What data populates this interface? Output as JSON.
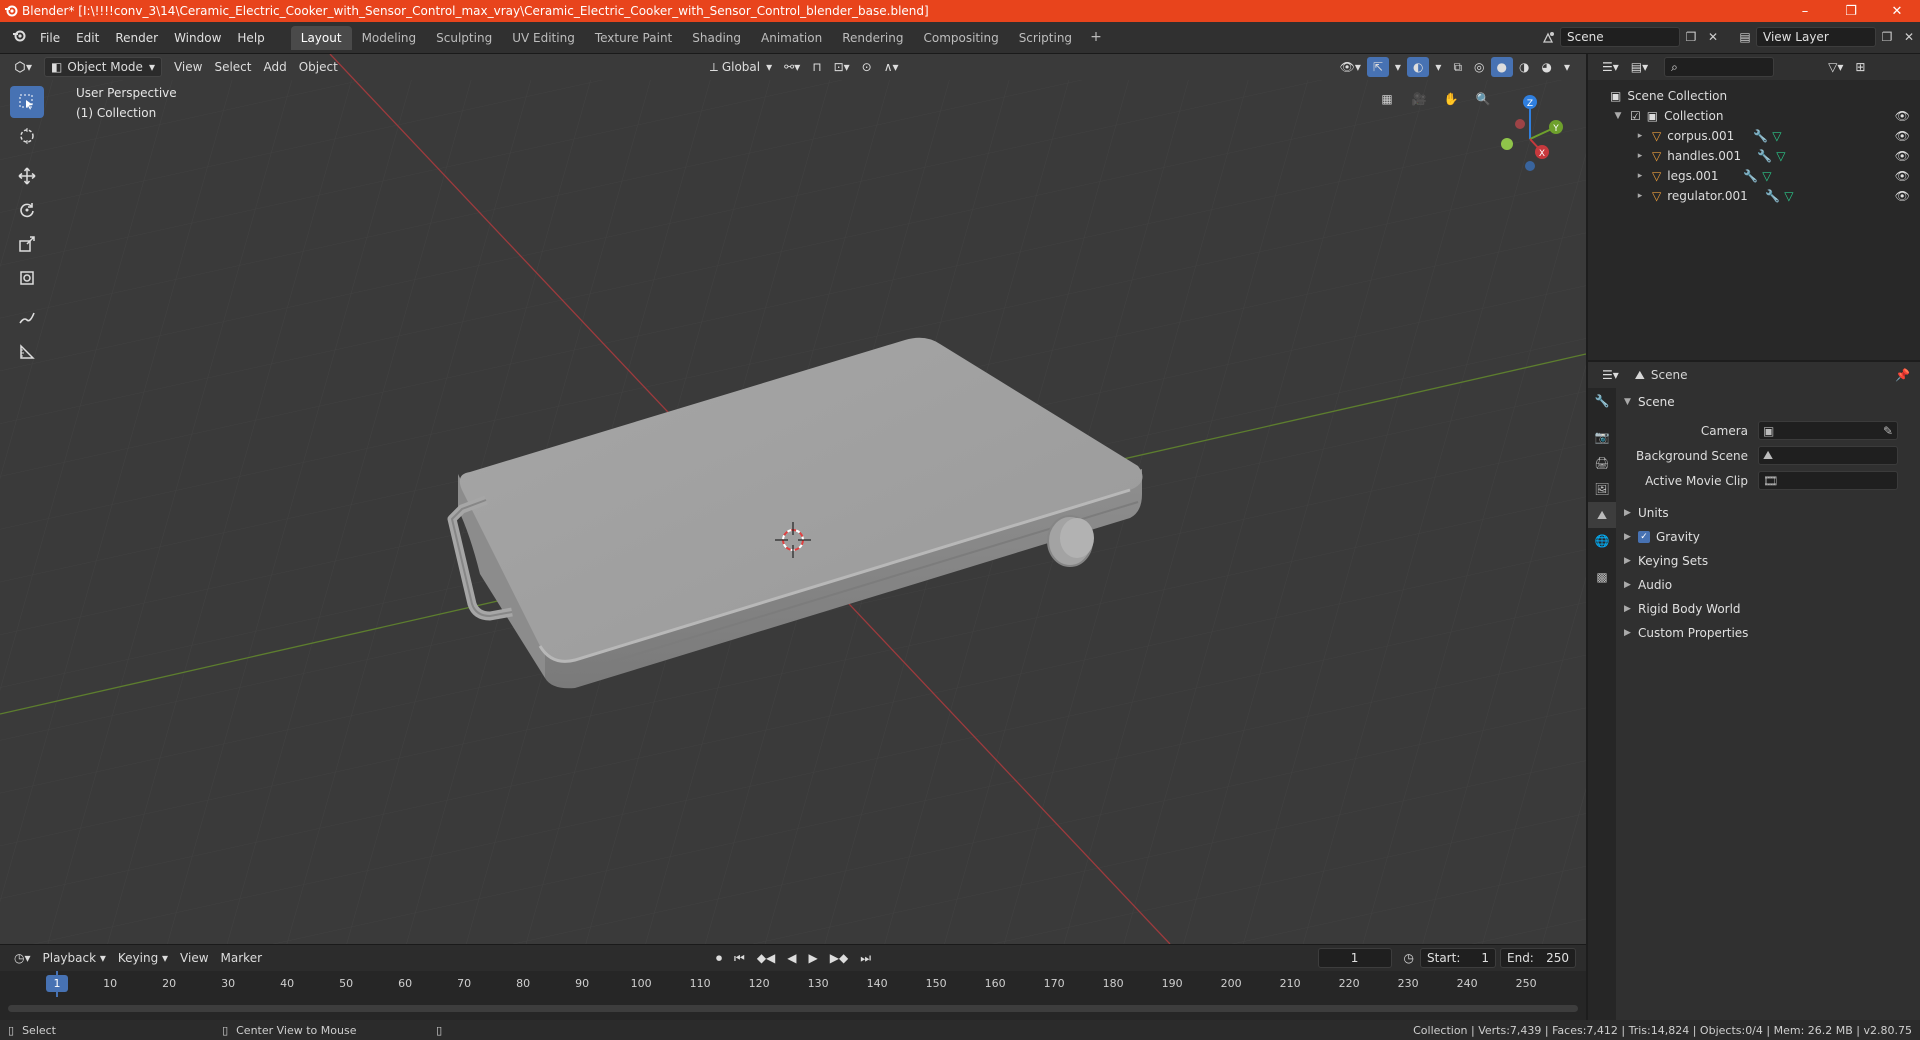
{
  "window": {
    "title": "Blender* [I:\\!!!!conv_3\\14\\Ceramic_Electric_Cooker_with_Sensor_Control_max_vray\\Ceramic_Electric_Cooker_with_Sensor_Control_blender_base.blend]",
    "minimize": "–",
    "maximize": "❐",
    "close": "✕"
  },
  "menu": [
    "File",
    "Edit",
    "Render",
    "Window",
    "Help"
  ],
  "workspaces": [
    "Layout",
    "Modeling",
    "Sculpting",
    "UV Editing",
    "Texture Paint",
    "Shading",
    "Animation",
    "Rendering",
    "Compositing",
    "Scripting"
  ],
  "active_workspace": "Layout",
  "scene_field": "Scene",
  "view_layer_field": "View Layer",
  "viewport": {
    "mode": "Object Mode",
    "menus": [
      "View",
      "Select",
      "Add",
      "Object"
    ],
    "transform_orientation": "Global",
    "perspective_label": "User Perspective",
    "collection_label": "(1) Collection",
    "gizmo_axes": {
      "x": "X",
      "y": "Y",
      "z": "Z"
    }
  },
  "timeline": {
    "menus": [
      "Playback",
      "Keying",
      "View",
      "Marker"
    ],
    "current_frame": "1",
    "start_label": "Start:",
    "start_value": "1",
    "end_label": "End:",
    "end_value": "250",
    "ticks": [
      "1",
      "10",
      "20",
      "30",
      "40",
      "50",
      "60",
      "70",
      "80",
      "90",
      "100",
      "110",
      "120",
      "130",
      "140",
      "150",
      "160",
      "170",
      "180",
      "190",
      "200",
      "210",
      "220",
      "230",
      "240",
      "250"
    ]
  },
  "statusbar": {
    "left_action": "Select",
    "mid_action": "Center View to Mouse",
    "stats": "Collection | Verts:7,439 | Faces:7,412 | Tris:14,824 | Objects:0/4 | Mem: 26.2 MB | v2.80.75"
  },
  "outliner": {
    "root": "Scene Collection",
    "collection": "Collection",
    "objects": [
      "corpus.001",
      "handles.001",
      "legs.001",
      "regulator.001"
    ]
  },
  "properties": {
    "header": "Scene",
    "section": "Scene",
    "fields": [
      {
        "label": "Camera",
        "value": ""
      },
      {
        "label": "Background Scene",
        "value": ""
      },
      {
        "label": "Active Movie Clip",
        "value": ""
      }
    ],
    "subsections": [
      "Units",
      "Gravity",
      "Keying Sets",
      "Audio",
      "Rigid Body World",
      "Custom Properties"
    ]
  },
  "colors": {
    "titlebar": "#e8441c",
    "accent": "#4772b3",
    "x_axis": "#c7393d",
    "y_axis": "#6ea02c",
    "z_axis": "#2f7fdf"
  }
}
